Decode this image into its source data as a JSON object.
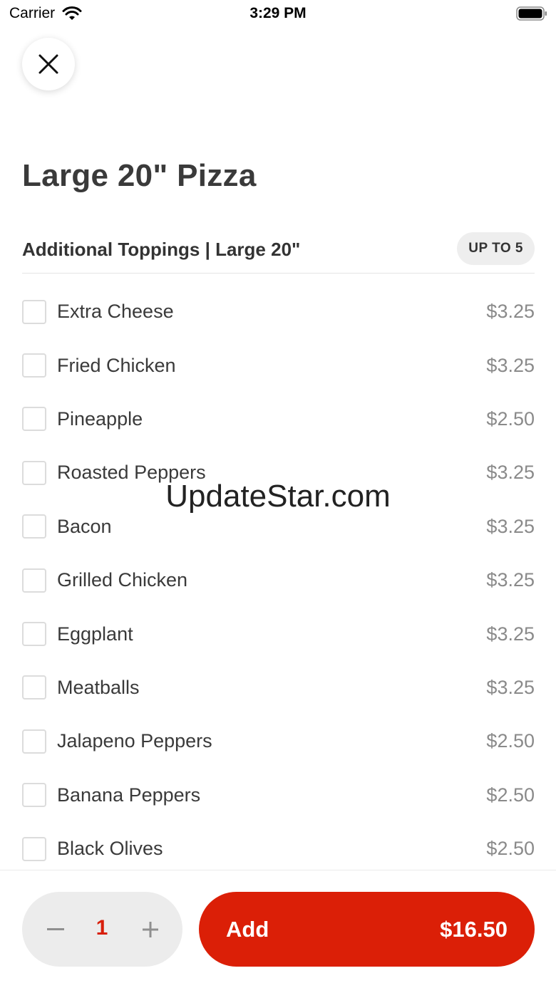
{
  "status_bar": {
    "carrier": "Carrier",
    "time": "3:29 PM",
    "wifi_icon": "wifi-icon",
    "battery_icon": "battery-icon"
  },
  "header": {
    "close_icon": "close-icon",
    "title": "Large 20\" Pizza"
  },
  "section": {
    "title": "Additional Toppings | Large 20\"",
    "badge": "UP TO 5"
  },
  "toppings": [
    {
      "name": "Extra Cheese",
      "price": "$3.25",
      "checked": false
    },
    {
      "name": "Fried Chicken",
      "price": "$3.25",
      "checked": false
    },
    {
      "name": "Pineapple",
      "price": "$2.50",
      "checked": false
    },
    {
      "name": "Roasted Peppers",
      "price": "$3.25",
      "checked": false
    },
    {
      "name": "Bacon",
      "price": "$3.25",
      "checked": false
    },
    {
      "name": "Grilled Chicken",
      "price": "$3.25",
      "checked": false
    },
    {
      "name": "Eggplant",
      "price": "$3.25",
      "checked": false
    },
    {
      "name": "Meatballs",
      "price": "$3.25",
      "checked": false
    },
    {
      "name": "Jalapeno Peppers",
      "price": "$2.50",
      "checked": false
    },
    {
      "name": "Banana Peppers",
      "price": "$2.50",
      "checked": false
    },
    {
      "name": "Black Olives",
      "price": "$2.50",
      "checked": false
    }
  ],
  "watermark": "UpdateStar.com",
  "footer": {
    "quantity": "1",
    "add_label": "Add",
    "total": "$16.50",
    "accent_color": "#db1f07"
  }
}
